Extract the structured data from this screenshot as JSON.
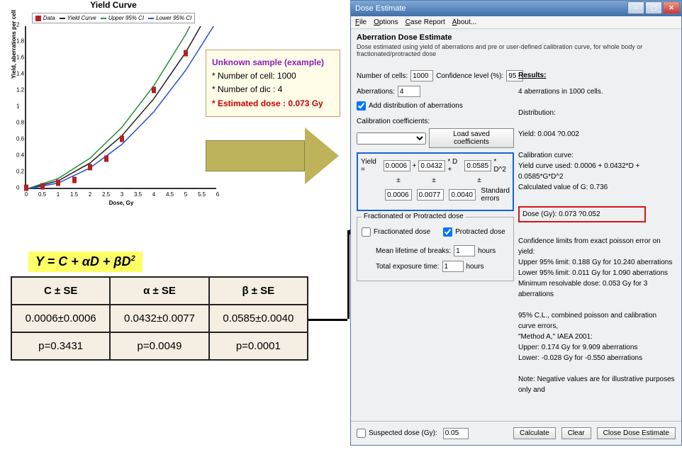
{
  "chart": {
    "title": "Yield Curve",
    "legend": {
      "data": "Data",
      "yield": "Yield Curve",
      "upper": "Upper 95% CI",
      "lower": "Lower 95% CI"
    },
    "xlabel": "Dose, Gy",
    "ylabel": "Yield, aberrations per cell",
    "xticks": [
      "0",
      "0.5",
      "1",
      "1.5",
      "2",
      "2.5",
      "3",
      "3.5",
      "4",
      "4.5",
      "5",
      "5.5",
      "6"
    ],
    "yticks": [
      "0",
      "0.2",
      "0.4",
      "0.6",
      "0.8",
      "1",
      "1.2",
      "1.4",
      "1.6",
      "1.8",
      "2"
    ]
  },
  "chart_data": {
    "type": "line",
    "xlabel": "Dose, Gy",
    "ylabel": "Yield, aberrations per cell",
    "xlim": [
      0,
      6
    ],
    "ylim": [
      0,
      2
    ],
    "series": [
      {
        "name": "Data",
        "x": [
          0,
          0.5,
          1,
          1.5,
          2,
          2.5,
          3,
          4,
          5
        ],
        "y": [
          0,
          0.02,
          0.06,
          0.1,
          0.25,
          0.36,
          0.6,
          1.2,
          1.65
        ],
        "style": "points",
        "color": "#b22222"
      },
      {
        "name": "Yield Curve",
        "x": [
          0,
          1,
          2,
          3,
          4,
          5,
          6
        ],
        "y": [
          0.0006,
          0.102,
          0.321,
          0.657,
          1.11,
          1.68,
          2.366
        ],
        "style": "line",
        "color": "#222"
      },
      {
        "name": "Upper 95% CI",
        "x": [
          0,
          1,
          2,
          3,
          4,
          5,
          6
        ],
        "y": [
          0.0018,
          0.13,
          0.38,
          0.76,
          1.27,
          1.9,
          2.65
        ],
        "style": "line",
        "color": "#2a8f3a"
      },
      {
        "name": "Lower 95% CI",
        "x": [
          0,
          1,
          2,
          3,
          4,
          5,
          6
        ],
        "y": [
          0,
          0.075,
          0.26,
          0.55,
          0.95,
          1.46,
          2.08
        ],
        "style": "line",
        "color": "#2a4fd6"
      }
    ]
  },
  "formula": {
    "text": "Y = C + αD + βD",
    "sup": "2"
  },
  "param_table": {
    "headers": [
      "C ± SE",
      "α ± SE",
      "β ± SE"
    ],
    "row1": [
      "0.0006±0.0006",
      "0.0432±0.0077",
      "0.0585±0.0040"
    ],
    "row2": [
      "p=0.3431",
      "p=0.0049",
      "p=0.0001"
    ]
  },
  "note": {
    "hdr": "Unknown sample (example)",
    "l1": "* Number of cell: 1000",
    "l2": "* Number of dic : 4",
    "l3": "* Estimated dose  : 0.073 Gy"
  },
  "app": {
    "title": "Dose Estimate",
    "menu": {
      "file": "File",
      "options": "Options",
      "case": "Case Report",
      "about": "About..."
    },
    "heading": "Aberration Dose Estimate",
    "sub": "Dose estimated using yield of aberrations and pre or user-defined calibration curve, for whole body or fractionated/protracted dose",
    "ncells_lbl": "Number of cells:",
    "ncells": "1000",
    "conf_lbl": "Confidence level (%):",
    "conf": "95",
    "ab_lbl": "Aberrations:",
    "ab": "4",
    "add_dist": "Add distribution of aberrations",
    "cal_lbl": "Calibration coefficients:",
    "load_btn": "Load saved coefficients",
    "yield_lbl": "Yield =",
    "c": "0.0006",
    "a": "0.0432",
    "b": "0.0585",
    "dstar": "* D +",
    "d2": "* D^2",
    "ce": "0.0006",
    "ae": "0.0077",
    "be": "0.0040",
    "se_lbl": "Standard errors",
    "pm": "±",
    "frac_title": "Fractionated or Protracted dose",
    "frac": "Fractionated dose",
    "prot": "Protracted dose",
    "mean_lbl": "Mean lifetime of breaks:",
    "mean_v": "1",
    "hours": "hours",
    "tot_lbl": "Total exposure time:",
    "tot_v": "1",
    "susp_lbl": "Suspected dose (Gy):",
    "susp_v": "0.05",
    "calc": "Calculate",
    "clear": "Clear",
    "close": "Close Dose Estimate",
    "res_title": "Results:",
    "res": {
      "l1": "4 aberrations in 1000 cells.",
      "l2": "Distribution:",
      "l3": "Yield: 0.004 ?0.002",
      "l4": "Calibration curve:",
      "l5": "Yield curve used: 0.0006 + 0.0432*D + 0.0585*G*D^2",
      "l6": "Calculated value of G: 0.736",
      "dose": "Dose (Gy): 0.073 ?0.052",
      "l7": "Confidence limits from exact poisson error on yield:",
      "l8": "Upper 95% limit: 0.188 Gy for 10.240 aberrations",
      "l9": "Lower 95% limit: 0.011 Gy for 1.090 aberrations",
      "l10": "Minimum resolvable dose: 0.053 Gy for 3 aberrations",
      "l11": "95% C.L., combined poisson and calibration curve errors,",
      "l12": "\"Method A,\" IAEA 2001:",
      "l13": "Upper: 0.174 Gy for 9.909 aberrations",
      "l14": "Lower: -0.028 Gy for -0.550 aberrations",
      "l15": "Note: Negative values are for illustrative purposes only and"
    }
  }
}
